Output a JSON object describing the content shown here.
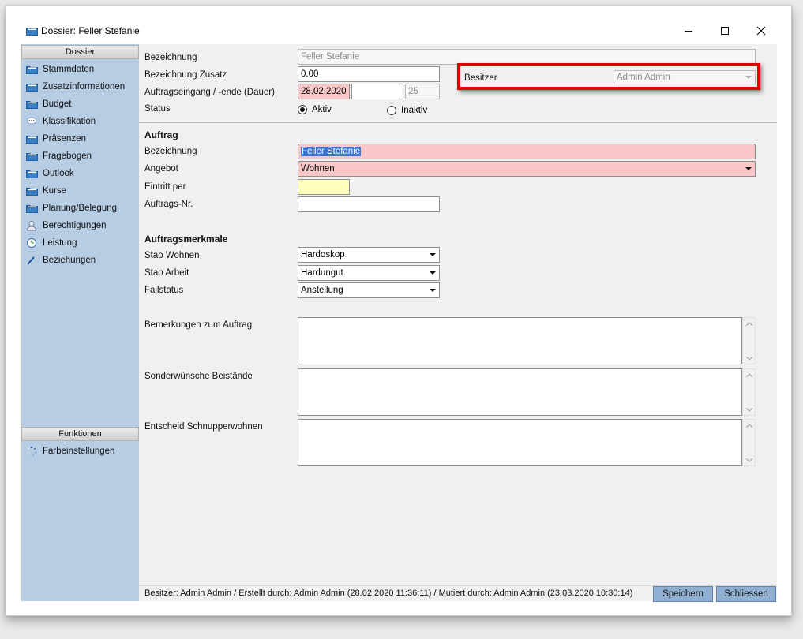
{
  "window": {
    "title": "Dossier: Feller Stefanie"
  },
  "sidebar": {
    "header": "Dossier",
    "items": [
      {
        "label": "Stammdaten",
        "icon": "folder-icon"
      },
      {
        "label": "Zusatzinformationen",
        "icon": "folder-icon"
      },
      {
        "label": "Budget",
        "icon": "folder-icon"
      },
      {
        "label": "Klassifikation",
        "icon": "chat-icon"
      },
      {
        "label": "Präsenzen",
        "icon": "folder-icon"
      },
      {
        "label": "Fragebogen",
        "icon": "folder-icon"
      },
      {
        "label": "Outlook",
        "icon": "folder-icon"
      },
      {
        "label": "Kurse",
        "icon": "folder-icon"
      },
      {
        "label": "Planung/Belegung",
        "icon": "folder-icon"
      },
      {
        "label": "Berechtigungen",
        "icon": "user-icon"
      },
      {
        "label": "Leistung",
        "icon": "clock-icon"
      },
      {
        "label": "Beziehungen",
        "icon": "pencil-icon"
      }
    ],
    "functions_header": "Funktionen",
    "functions": [
      {
        "label": "Farbeinstellungen",
        "icon": "spinner-icon"
      }
    ]
  },
  "form": {
    "bezeichnung_label": "Bezeichnung",
    "bezeichnung_value": "Feller Stefanie",
    "zusatz_label": "Bezeichnung Zusatz",
    "zusatz_value": "0.00",
    "auftragseingang_label": "Auftragseingang / -ende (Dauer)",
    "auftragseingang_value": "28.02.2020",
    "auftragsende_value": "",
    "dauer_value": "25",
    "status_label": "Status",
    "status_aktiv": "Aktiv",
    "status_inaktiv": "Inaktiv",
    "besitzer_label": "Besitzer",
    "besitzer_value": "Admin Admin"
  },
  "auftrag": {
    "title": "Auftrag",
    "bezeichnung_label": "Bezeichnung",
    "bezeichnung_value": "Feller Stefanie",
    "angebot_label": "Angebot",
    "angebot_value": "Wohnen",
    "eintritt_label": "Eintritt per",
    "eintritt_value": "",
    "nr_label": "Auftrags-Nr.",
    "nr_value": ""
  },
  "merkmale": {
    "title": "Auftragsmerkmale",
    "stao_wohnen_label": "Stao Wohnen",
    "stao_wohnen_value": "Hardoskop",
    "stao_arbeit_label": "Stao Arbeit",
    "stao_arbeit_value": "Hardungut",
    "fallstatus_label": "Fallstatus",
    "fallstatus_value": "Anstellung"
  },
  "notes": {
    "bemerkungen_label": "Bemerkungen zum Auftrag",
    "sonderwuensche_label": "Sonderwünsche Beistände",
    "entscheid_label": "Entscheid Schnupperwohnen"
  },
  "footer": {
    "status": "Besitzer: Admin Admin / Erstellt durch: Admin Admin (28.02.2020 11:36:11) / Mutiert durch: Admin Admin (23.03.2020 10:30:14)",
    "save_label": "Speichern",
    "close_label": "Schliessen"
  },
  "colors": {
    "sidebar_bg": "#b7cde3",
    "required_field": "#f8c6c6",
    "date_field": "#ffffc0",
    "highlight": "#e10000",
    "button_bg": "#8fb0d2"
  }
}
